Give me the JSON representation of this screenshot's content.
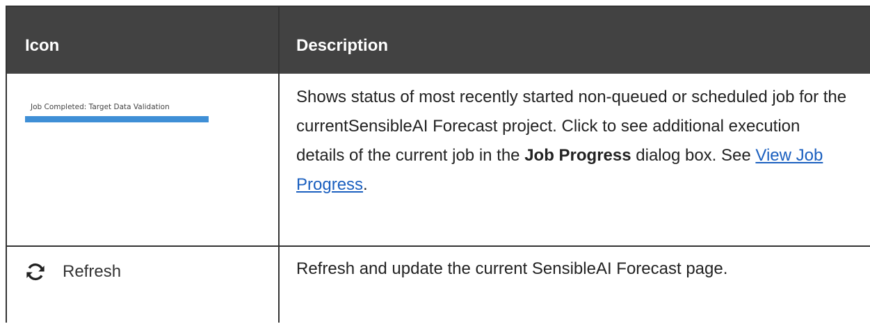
{
  "header": {
    "icon_col": "Icon",
    "description_col": "Description"
  },
  "rows": [
    {
      "job_status": {
        "text": "Job Completed: Target Data Validation",
        "progress": 1.0
      },
      "desc": {
        "part1": "Shows status of most recently started non-queued or scheduled job for the currentSensibleAI Forecast project. Click to see additional execution details of the current job in the ",
        "bold1": "Job Progress",
        "part2": " dialog box. See ",
        "link": "View Job Progress",
        "part3": "."
      }
    },
    {
      "icon": "refresh-icon",
      "label": "Refresh",
      "desc": "Refresh and update the current SensibleAI Forecast page."
    }
  ],
  "colors": {
    "header_bg": "#424242",
    "progress_fill": "#3f8fd6",
    "link": "#1a5fbf"
  }
}
